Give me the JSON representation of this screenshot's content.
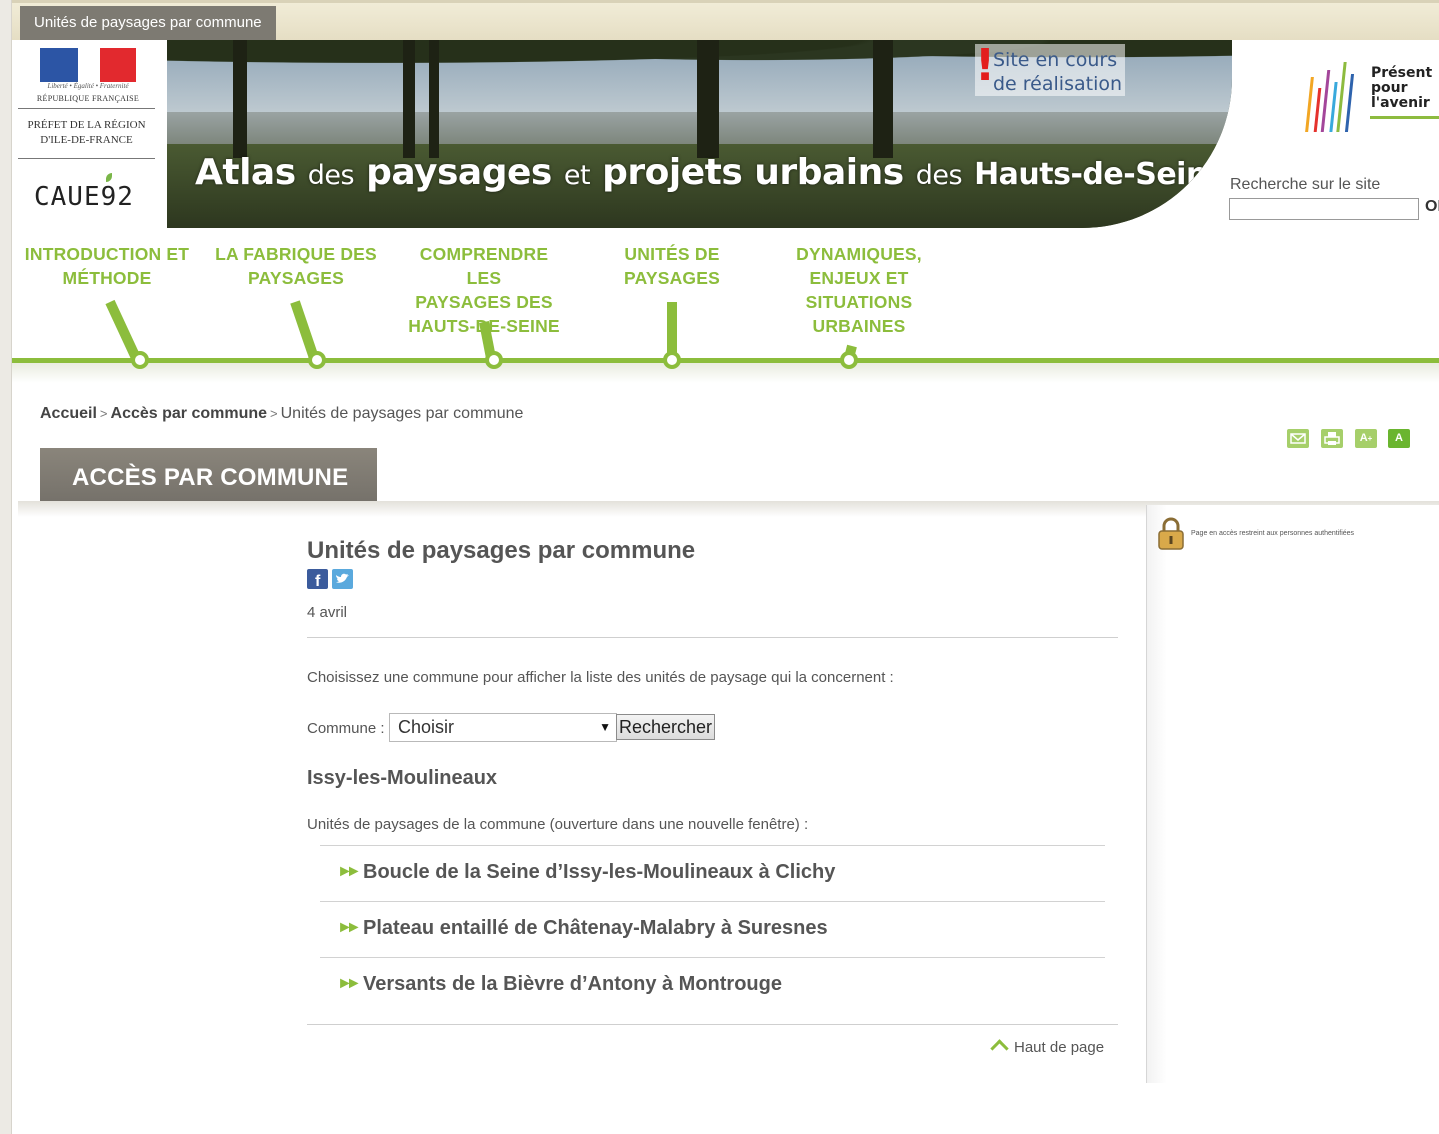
{
  "window_tab": "Unités de paysages par commune",
  "header": {
    "motto": "Liberté • Égalité • Fraternité",
    "republic": "RÉPUBLIQUE FRANÇAISE",
    "prefet": "PRÉFET DE LA RÉGION D'ILE-DE-FRANCE",
    "caue": "CAUE92",
    "title_part1": "Atlas",
    "title_part2": "des",
    "title_part3": "paysages",
    "title_part4": "et",
    "title_part5": "projets urbains",
    "title_part6": "des",
    "title_part7": "Hauts-de-Seine",
    "badge_line1": "Site en cours",
    "badge_line2": "de réalisation",
    "ppa_line1": "Présent",
    "ppa_line2": "pour",
    "ppa_line3": "l'avenir",
    "search_label": "Recherche sur le site",
    "search_value": "",
    "search_ok": "OK"
  },
  "nav": [
    {
      "line1": "INTRODUCTION ET",
      "line2": "MÉTHODE",
      "line3": "",
      "line4": ""
    },
    {
      "line1": "LA FABRIQUE DES",
      "line2": "PAYSAGES",
      "line3": "",
      "line4": ""
    },
    {
      "line1": "COMPRENDRE LES",
      "line2": "PAYSAGES DES",
      "line3": "HAUTS-DE-SEINE",
      "line4": ""
    },
    {
      "line1": "UNITÉS DE PAYSAGES",
      "line2": "",
      "line3": "",
      "line4": ""
    },
    {
      "line1": "DYNAMIQUES,",
      "line2": "ENJEUX ET",
      "line3": "SITUATIONS",
      "line4": "URBAINES"
    }
  ],
  "breadcrumb": {
    "home": "Accueil",
    "section": "Accès par commune",
    "current": "Unités de paysages par commune",
    "separator": ">"
  },
  "tools": {
    "mail_icon": "mail-icon",
    "print_icon": "print-icon",
    "text_size_label": "A",
    "text_size_plus": "+",
    "contrast_label": "A"
  },
  "section_tab": "ACCÈS PAR COMMUNE",
  "sidebar": {
    "restricted_note": "Page en accès restreint aux personnes authentifiées"
  },
  "article": {
    "title": "Unités de paysages par commune",
    "date": "4 avril",
    "intro": "Choisissez une commune pour afficher la liste des unités de paysage qui la concernent :",
    "commune_label": "Commune :",
    "select_value": "Choisir",
    "search_button": "Rechercher",
    "commune_name": "Issy-les-Moulineaux",
    "units_intro": "Unités de paysages de la commune (ouverture dans une nouvelle fenêtre) :",
    "units": [
      "Boucle de la Seine d’Issy-les-Moulineaux à Clichy",
      "Plateau entaillé de Châtenay-Malabry à Suresnes",
      "Versants de la Bièvre d’Antony à Montrouge"
    ],
    "top_link": "Haut de page"
  },
  "colors": {
    "accent_green": "#8cbd3c",
    "tab_gray": "#7d7a72",
    "text_gray": "#555555"
  }
}
